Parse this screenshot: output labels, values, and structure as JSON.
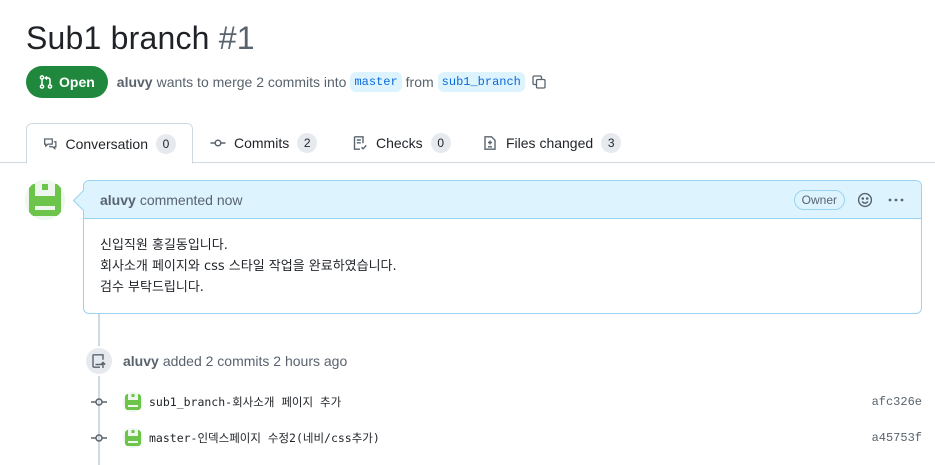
{
  "pr": {
    "title": "Sub1 branch",
    "number": "#1",
    "state": "Open",
    "author": "aluvy",
    "merge_text_1": "wants to merge 2 commits into",
    "base_branch": "master",
    "from_text": "from",
    "head_branch": "sub1_branch",
    "state_color": "#1f883d"
  },
  "tabs": [
    {
      "label": "Conversation",
      "count": "0",
      "icon": "comment-discussion-icon"
    },
    {
      "label": "Commits",
      "count": "2",
      "icon": "git-commit-icon"
    },
    {
      "label": "Checks",
      "count": "0",
      "icon": "checklist-icon"
    },
    {
      "label": "Files changed",
      "count": "3",
      "icon": "file-diff-icon"
    }
  ],
  "comment": {
    "author": "aluvy",
    "action": "commented now",
    "badge": "Owner",
    "body": [
      "신입직원 홍길동입니다.",
      "회사소개 페이지와 css 스타일 작업을 완료하였습니다.",
      "검수 부탁드립니다."
    ]
  },
  "event": {
    "author": "aluvy",
    "text": "added 2 commits 2 hours ago"
  },
  "commits": [
    {
      "message": "sub1_branch-회사소개 페이지 추가",
      "sha": "afc326e"
    },
    {
      "message": "master-인덱스페이지 수정2(네비/css추가)",
      "sha": "a45753f"
    }
  ]
}
